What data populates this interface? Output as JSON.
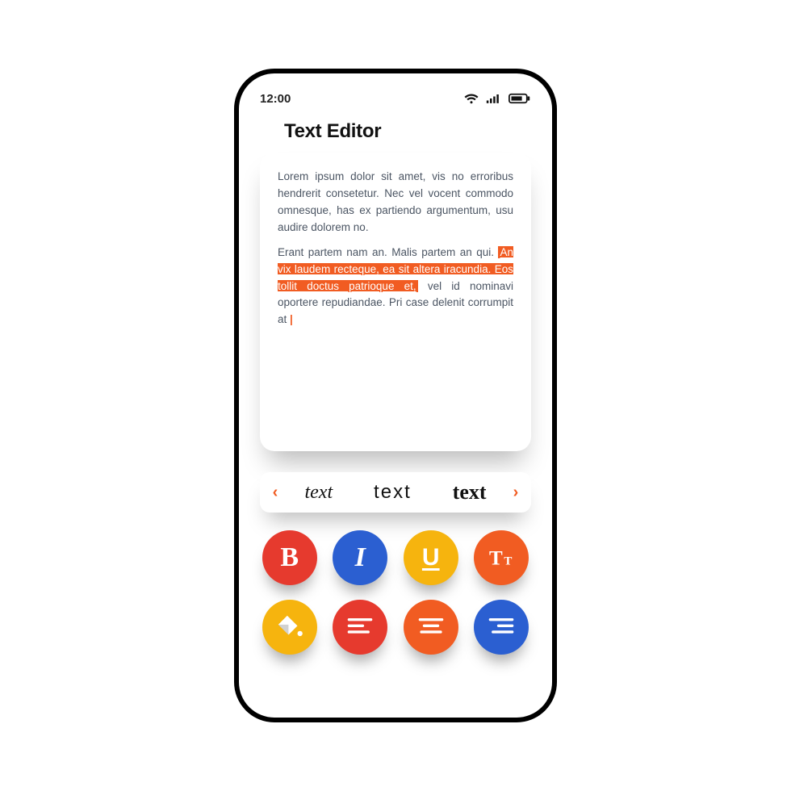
{
  "status": {
    "time": "12:00"
  },
  "title": "Text Editor",
  "editor": {
    "para1": "Lorem ipsum dolor sit amet, vis no erroribus hendrerit consetetur. Nec vel vocent commodo omnesque, has ex partiendo argumentum, usu audire dolorem no.",
    "para2_pre": "Erant partem nam an. Malis partem an qui. ",
    "para2_hl": "An vix laudem recteque, ea sit altera iracundia. Eos tollit doctus patrioque et,",
    "para2_post": " vel id nominavi oportere repudiandae. Pri case delenit corrumpit at ",
    "caret": "|"
  },
  "fontPicker": {
    "prev": "‹",
    "opts": [
      "text",
      "text",
      "text"
    ],
    "next": "›"
  },
  "tools": {
    "bold": "B",
    "italic": "I",
    "underline": "U"
  }
}
